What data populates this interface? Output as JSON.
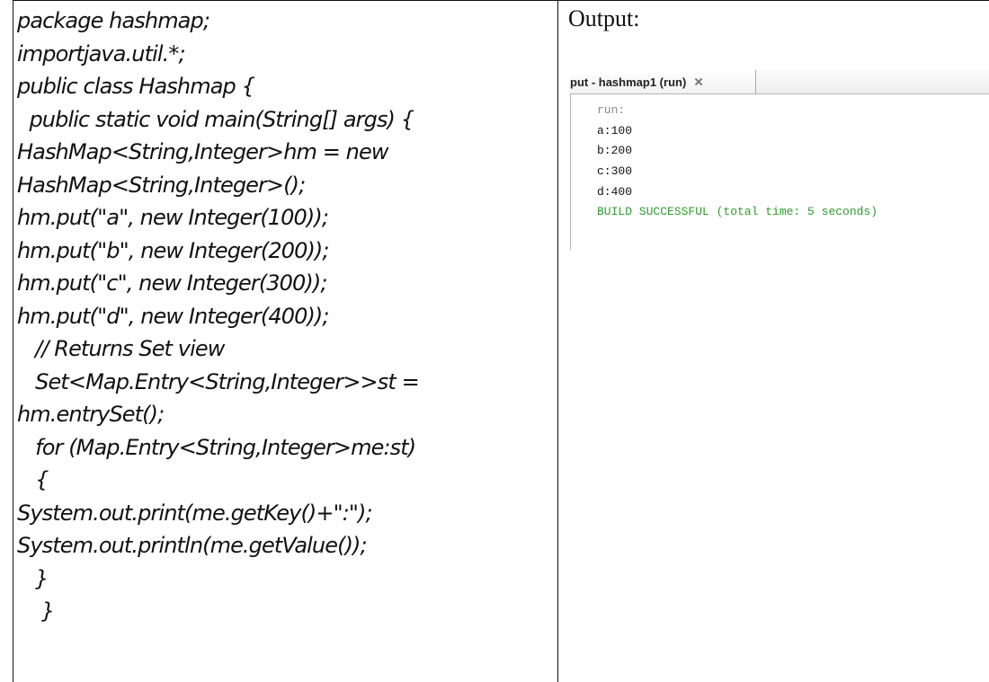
{
  "code": {
    "lines": [
      "package hashmap;",
      "importjava.util.*;",
      "public class Hashmap {",
      "  public static void main(String[] args) {",
      "HashMap<String,Integer>hm = new",
      "HashMap<String,Integer>();",
      "hm.put(\"a\", new Integer(100));",
      "hm.put(\"b\", new Integer(200));",
      "hm.put(\"c\", new Integer(300));",
      "hm.put(\"d\", new Integer(400));",
      "   // Returns Set view",
      "   Set<Map.Entry<String,Integer>>st =",
      "hm.entrySet();",
      "   for (Map.Entry<String,Integer>me:st)",
      "   {",
      "System.out.print(me.getKey()+\":\");",
      "System.out.println(me.getValue());",
      "   }",
      "    }"
    ]
  },
  "output": {
    "title": "Output:",
    "ide": {
      "tab_label": "put - hashmap1 (run)",
      "close_icon": "close-icon",
      "run_label": "run:",
      "results": [
        "a:100",
        "b:200",
        "c:300",
        "d:400"
      ],
      "status": "BUILD SUCCESSFUL (total time: 5 seconds)",
      "status_color": "#2e9b2e"
    }
  }
}
